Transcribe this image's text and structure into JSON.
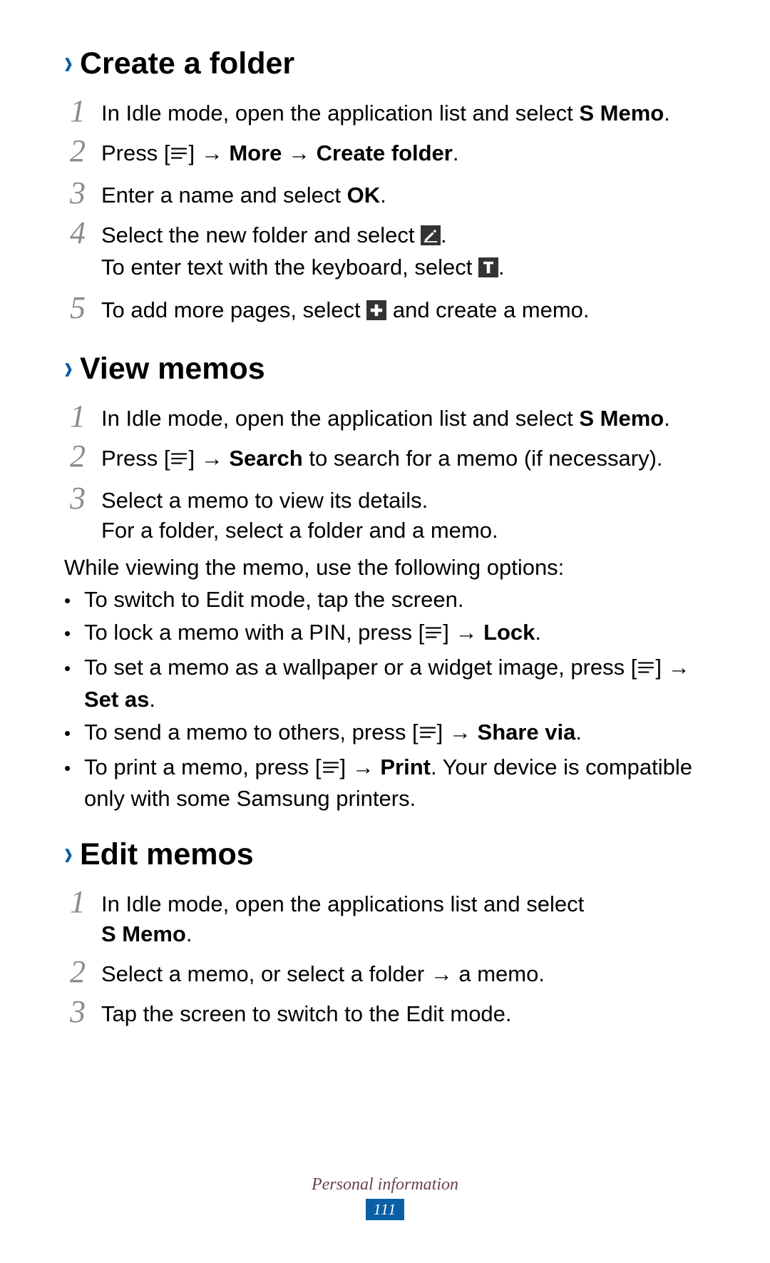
{
  "footer": {
    "label": "Personal information",
    "page": "111"
  },
  "sections": {
    "create_folder": {
      "title": "Create a folder",
      "steps": {
        "1": [
          {
            "t": "In Idle mode, open the application list and select "
          },
          {
            "t": "S Memo",
            "b": true
          },
          {
            "t": "."
          }
        ],
        "2": [
          {
            "t": "Press ["
          },
          {
            "icon": "menu-icon"
          },
          {
            "t": "] "
          },
          {
            "t": "→ ",
            "arrow": true
          },
          {
            "t": "More",
            "b": true
          },
          {
            "t": " → ",
            "arrow": true
          },
          {
            "t": "Create folder",
            "b": true
          },
          {
            "t": "."
          }
        ],
        "3": [
          {
            "t": "Enter a name and select "
          },
          {
            "t": "OK",
            "b": true
          },
          {
            "t": "."
          }
        ],
        "4": [
          {
            "t": "Select the new folder and select "
          },
          {
            "icon": "pencil-icon"
          },
          {
            "t": "."
          },
          {
            "br": true
          },
          {
            "t": "To enter text with the keyboard, select "
          },
          {
            "icon": "text-icon"
          },
          {
            "t": "."
          }
        ],
        "5": [
          {
            "t": "To add more pages, select "
          },
          {
            "icon": "add-page-icon"
          },
          {
            "t": " and create a memo."
          }
        ]
      }
    },
    "view_memos": {
      "title": "View memos",
      "steps": {
        "1": [
          {
            "t": "In Idle mode, open the application list and select "
          },
          {
            "t": "S Memo",
            "b": true
          },
          {
            "t": "."
          }
        ],
        "2": [
          {
            "t": "Press ["
          },
          {
            "icon": "menu-icon"
          },
          {
            "t": "] "
          },
          {
            "t": "→ ",
            "arrow": true
          },
          {
            "t": "Search",
            "b": true
          },
          {
            "t": " to search for a memo (if necessary)."
          }
        ],
        "3": [
          {
            "t": "Select a memo to view its details."
          },
          {
            "br": true
          },
          {
            "t": "For a folder, select a folder and a memo."
          }
        ]
      },
      "para": "While viewing the memo, use the following options:",
      "bullets": [
        [
          {
            "t": "To switch to Edit mode, tap the screen."
          }
        ],
        [
          {
            "t": "To lock a memo with a PIN, press ["
          },
          {
            "icon": "menu-icon"
          },
          {
            "t": "] → "
          },
          {
            "t": "Lock",
            "b": true
          },
          {
            "t": "."
          }
        ],
        [
          {
            "t": "To set a memo as a wallpaper or a widget image, press ["
          },
          {
            "icon": "menu-icon"
          },
          {
            "t": "] → "
          },
          {
            "t": "Set as",
            "b": true
          },
          {
            "t": "."
          }
        ],
        [
          {
            "t": "To send a memo to others, press ["
          },
          {
            "icon": "menu-icon"
          },
          {
            "t": "] → "
          },
          {
            "t": "Share via",
            "b": true
          },
          {
            "t": "."
          }
        ],
        [
          {
            "t": "To print a memo, press ["
          },
          {
            "icon": "menu-icon"
          },
          {
            "t": "] → "
          },
          {
            "t": "Print",
            "b": true
          },
          {
            "t": ". Your device is compatible only with some Samsung printers."
          }
        ]
      ]
    },
    "edit_memos": {
      "title": "Edit memos",
      "steps": {
        "1": [
          {
            "t": "In Idle mode, open the applications list and select "
          },
          {
            "br": true
          },
          {
            "t": "S Memo",
            "b": true
          },
          {
            "t": "."
          }
        ],
        "2": [
          {
            "t": "Select a memo, or select a folder → a memo."
          }
        ],
        "3": [
          {
            "t": "Tap the screen to switch to the Edit mode."
          }
        ]
      }
    }
  }
}
